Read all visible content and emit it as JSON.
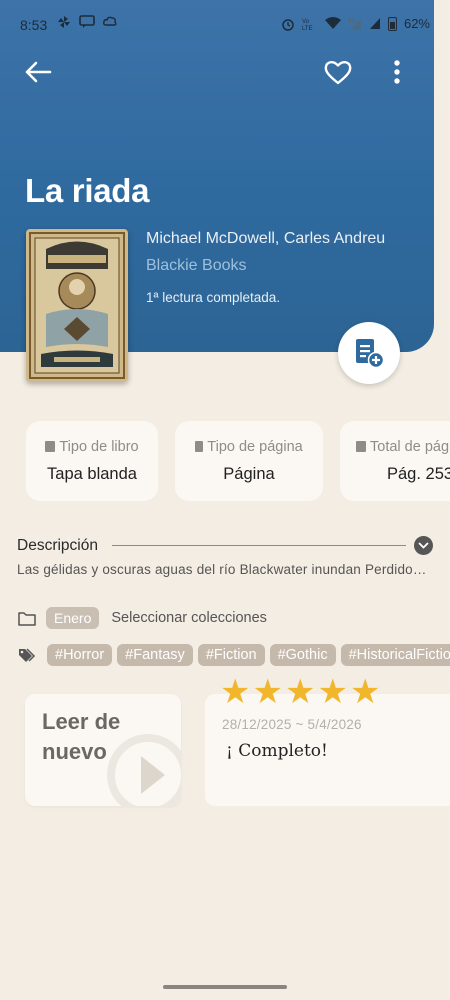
{
  "status_bar": {
    "time": "8:53",
    "battery": "62%",
    "icons": [
      "pinwheel-icon",
      "message-icon",
      "cloud-icon",
      "alarm-icon",
      "volte-icon",
      "wifi-icon",
      "signal-5g-icon",
      "signal-icon",
      "battery-icon"
    ]
  },
  "header": {
    "title": "La riada",
    "authors": "Michael McDowell, Carles Andreu",
    "publisher": "Blackie Books",
    "reading_status": "1ª lectura completada.",
    "background_color": "#2f6a9f"
  },
  "stats": [
    {
      "label": "Tipo de libro",
      "value": "Tapa blanda",
      "icon": "book-icon"
    },
    {
      "label": "Tipo de página",
      "value": "Página",
      "icon": "bookmark-icon"
    },
    {
      "label": "Total de páginas",
      "value": "Pág. 253",
      "icon": "book-open-icon"
    }
  ],
  "description": {
    "label": "Descripción",
    "text": "Las gélidas y oscuras aguas del río Blackwater inundan Perdido…"
  },
  "collections": {
    "chip": "Enero",
    "link": "Seleccionar colecciones"
  },
  "tags": [
    "#Horror",
    "#Fantasy",
    "#Fiction",
    "#Gothic",
    "#HistoricalFiction"
  ],
  "reread": {
    "label": "Leer de nuevo"
  },
  "review": {
    "rating": 5,
    "max_rating": 5,
    "dates": "28/12/2025 ~ 5/4/2026",
    "text": "¡ Completo!"
  },
  "colors": {
    "accent": "#2f6a9f",
    "star": "#f2b62c",
    "background": "#f3ede3"
  }
}
